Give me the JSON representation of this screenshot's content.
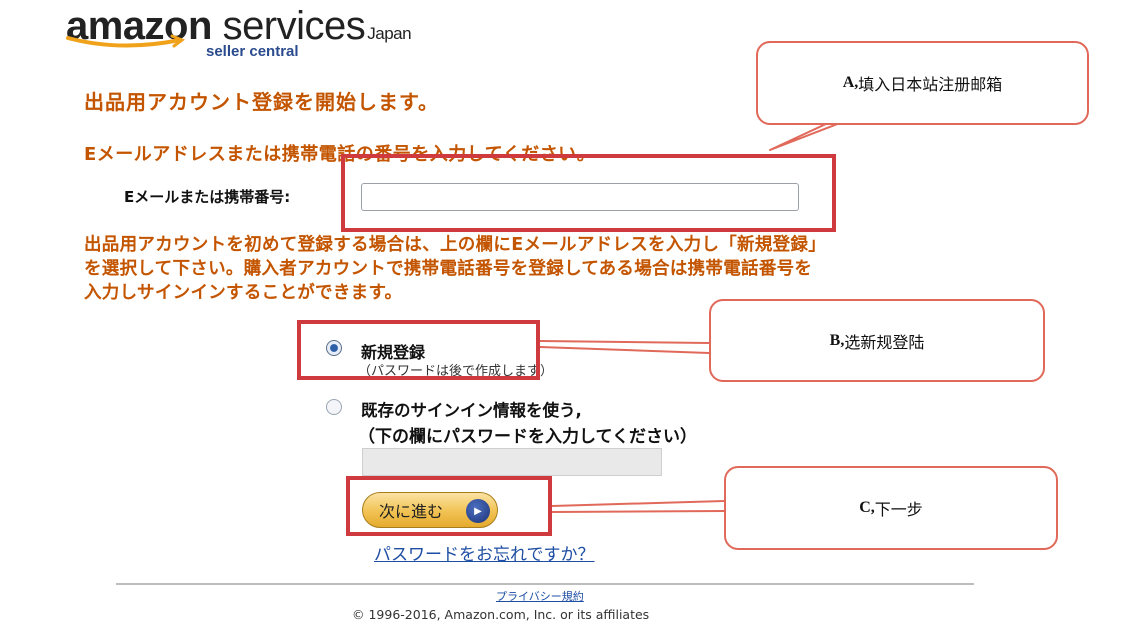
{
  "logo": {
    "brand": "amazon",
    "services": "services",
    "region": "Japan",
    "sub": "seller central"
  },
  "heading": "出品用アカウント登録を開始します。",
  "subheading": "Eメールアドレスまたは携帯電話の番号を入力してください。",
  "email": {
    "label": "Eメールまたは携帯番号:",
    "value": "",
    "placeholder": ""
  },
  "instructions": [
    "出品用アカウントを初めて登録する場合は、上の欄にEメールアドレスを入力し「新規登録」",
    "を選択して下さい。購入者アカウントで携帯電話番号を登録してある場合は携帯電話番号を",
    "入力しサインインすることができます。"
  ],
  "options": {
    "new": {
      "label": "新規登録",
      "note": "（パスワードは後で作成します）",
      "selected": true
    },
    "existing": {
      "label": "既存のサインイン情報を使う,",
      "note": "（下の欄にパスワードを入力してください）",
      "selected": false
    }
  },
  "password": {
    "value": ""
  },
  "next_button": {
    "label": "次に進む"
  },
  "forgot_link": "パスワードをお忘れですか？",
  "footer": {
    "privacy": "プライバシー規約",
    "copyright": "© 1996-2016, Amazon.com, Inc. or its affiliates"
  },
  "annotations": {
    "a": {
      "key": "A,",
      "text": "填入日本站注册邮箱"
    },
    "b": {
      "key": "B,",
      "text": "选新规登陆"
    },
    "c": {
      "key": "C,",
      "text": "下一步"
    }
  },
  "colors": {
    "accent_orange": "#c45500",
    "highlight_red": "#cf3a3e",
    "callout_border": "#e0695a",
    "link_blue": "#1d4ea3",
    "button_gold": "#f1c253"
  }
}
